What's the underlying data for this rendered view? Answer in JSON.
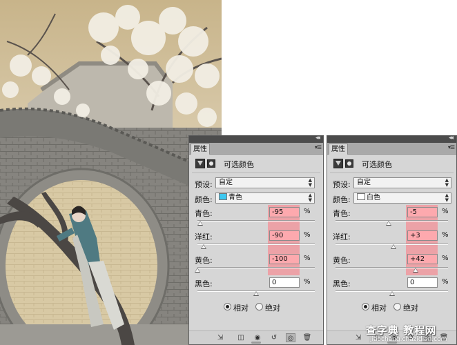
{
  "panels": [
    {
      "tab_label": "属性",
      "title": "可选颜色",
      "preset_label": "预设:",
      "preset_value": "自定",
      "colors_label": "颜色:",
      "colors_value": "青色",
      "colors_swatch": "#3ec8f0",
      "sliders": [
        {
          "label": "青色:",
          "value": "-95",
          "level": -95
        },
        {
          "label": "洋红:",
          "value": "-90",
          "level": -90
        },
        {
          "label": "黄色:",
          "value": "-100",
          "level": -100
        },
        {
          "label": "黑色:",
          "value": "0",
          "level": 0
        }
      ],
      "percent": "%",
      "mode_relative": "相对",
      "mode_absolute": "绝对",
      "mode_selected": "relative"
    },
    {
      "tab_label": "属性",
      "title": "可选颜色",
      "preset_label": "预设:",
      "preset_value": "自定",
      "colors_label": "颜色:",
      "colors_value": "白色",
      "colors_swatch": "#ffffff",
      "sliders": [
        {
          "label": "青色:",
          "value": "-5",
          "level": -5
        },
        {
          "label": "洋红:",
          "value": "+3",
          "level": 3
        },
        {
          "label": "黄色:",
          "value": "+42",
          "level": 42
        },
        {
          "label": "黑色:",
          "value": "0",
          "level": 0
        }
      ],
      "percent": "%",
      "mode_relative": "相对",
      "mode_absolute": "绝对",
      "mode_selected": "relative"
    }
  ],
  "colors": {
    "highlight": "#ff7882",
    "panel_bg": "#d6d6d6",
    "title_bar": "#4c4c4c"
  },
  "icons": {
    "topbar_collapse": "double-chevron-icon",
    "panel_menu": "panel-menu-icon",
    "adjustment": "selective-color-icon",
    "mask": "layer-mask-icon",
    "bottom": [
      "clip-to-layer-icon",
      "view-previous-icon",
      "visibility-eye-icon",
      "reset-icon",
      "toggle-visibility-icon",
      "trash-icon"
    ]
  },
  "watermark": {
    "main": "查字典 教程网",
    "sub": "jiaocheng.chazidian.com"
  }
}
